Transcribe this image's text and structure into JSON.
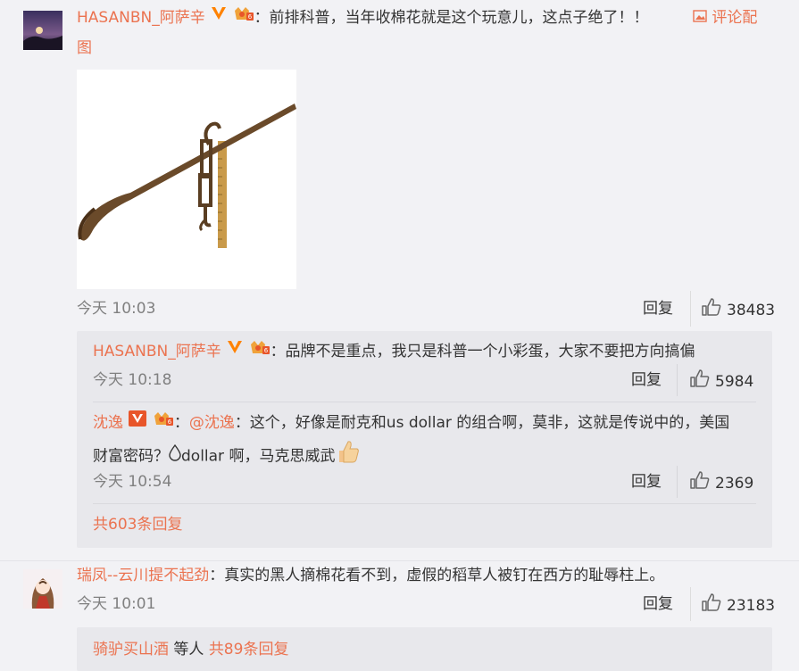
{
  "comment1": {
    "username": "HASANBN_阿萨辛",
    "text": "：前排科普，当年收棉花就是这个玩意儿，这点子绝了！！",
    "attachment_label": "评论配图",
    "time": "今天 10:03",
    "reply_label": "回复",
    "likes": "38483",
    "image_icon": "image-icon"
  },
  "replies": [
    {
      "username": "HASANBN_阿萨辛",
      "text": "：品牌不是重点，我只是科普一个小彩蛋，大家不要把方向搞偏",
      "time": "今天 10:18",
      "reply_label": "回复",
      "likes": "5984"
    },
    {
      "username": "沈逸",
      "mention": "@沈逸",
      "text_line1": "：这个，好像是耐克和us dollar 的组合啊，莫非，这就是传说中的，美国",
      "text_line2": "财富密码？",
      "text_line2b": "dollar 啊，马克思威武",
      "time": "今天 10:54",
      "reply_label": "回复",
      "likes": "2369"
    }
  ],
  "more_replies": "共603条回复",
  "comment2": {
    "username": "瑞凤--云川提不起劲",
    "text": "：真实的黑人摘棉花看不到，虚假的稻草人被钉在西方的耻辱柱上。",
    "time": "今天 10:01",
    "reply_label": "回复",
    "likes": "23183",
    "sub_user": "骑驴买山酒",
    "sub_middle": " 等人 ",
    "sub_count": "共89条回复"
  },
  "colors": {
    "accent": "#eb7350",
    "vip": "#ff8200",
    "bg": "#f2f2f5",
    "reply_bg": "#e8e8ec"
  }
}
